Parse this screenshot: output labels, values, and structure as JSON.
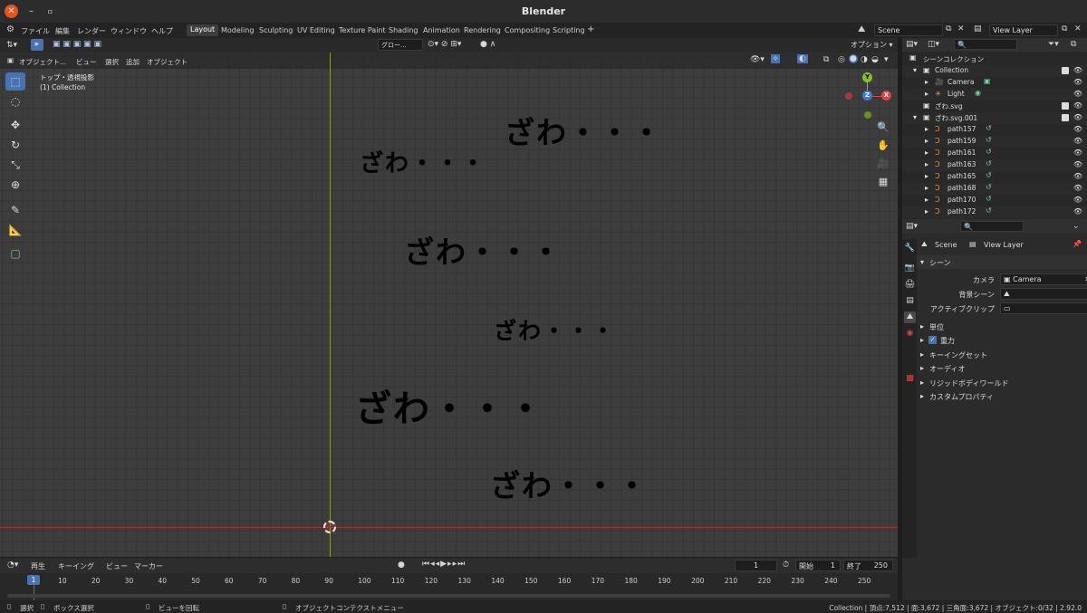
{
  "window": {
    "title": "Blender"
  },
  "menus": [
    "ファイル",
    "編集",
    "レンダー",
    "ウィンドウ",
    "ヘルプ"
  ],
  "workspaces": [
    "Layout",
    "Modeling",
    "Sculpting",
    "UV Editing",
    "Texture Paint",
    "Shading",
    "Animation",
    "Rendering",
    "Compositing",
    "Scripting"
  ],
  "active_workspace": "Layout",
  "scene_field": "Scene",
  "viewlayer_field": "View Layer",
  "viewport": {
    "mode": "オブジェクト...",
    "menu": [
      "ビュー",
      "選択",
      "追加",
      "オブジェクト"
    ],
    "transform": "グロー...",
    "options": "オプション",
    "overlay_title": "トップ・透視投影",
    "overlay_collection": "(1) Collection",
    "texts": [
      "ざわ・・・",
      "ざわ・・・",
      "ざわ・・・",
      "ざわ・・・",
      "ざわ・・・",
      "ざわ・・・"
    ],
    "gizmo": {
      "y": "Y",
      "z": "Z",
      "x": "X"
    }
  },
  "outliner": {
    "root": "シーンコレクション",
    "rows": [
      {
        "label": "Collection"
      },
      {
        "label": "Camera"
      },
      {
        "label": "Light"
      },
      {
        "label": "ざわ.svg"
      },
      {
        "label": "ざわ.svg.001"
      },
      {
        "label": "path157"
      },
      {
        "label": "path159"
      },
      {
        "label": "path161"
      },
      {
        "label": "path163"
      },
      {
        "label": "path165"
      },
      {
        "label": "path168"
      },
      {
        "label": "path170"
      },
      {
        "label": "path172"
      }
    ]
  },
  "properties": {
    "breadcrumb_scene": "Scene",
    "breadcrumb_layer": "View Layer",
    "section_scene": "シーン",
    "camera_label": "カメラ",
    "camera_value": "Camera",
    "bg_scene_label": "背景シーン",
    "active_clip_label": "アクティブクリップ",
    "panels": [
      "単位",
      "重力",
      "キーイングセット",
      "オーディオ",
      "リジッドボディワールド",
      "カスタムプロパティ"
    ]
  },
  "timeline": {
    "menu": [
      "再生",
      "キーイング",
      "ビュー",
      "マーカー"
    ],
    "current_frame": "1",
    "start_label": "開始",
    "start_value": "1",
    "end_label": "終了",
    "end_value": "250",
    "ticks": [
      "1",
      "10",
      "20",
      "30",
      "40",
      "50",
      "60",
      "70",
      "80",
      "90",
      "100",
      "110",
      "120",
      "130",
      "140",
      "150",
      "160",
      "170",
      "180",
      "190",
      "200",
      "210",
      "220",
      "230",
      "240",
      "250"
    ]
  },
  "status": {
    "select": "選択",
    "box_select": "ボックス選択",
    "rotate_view": "ビューを回転",
    "context_menu": "オブジェクトコンテクストメニュー",
    "stats": "Collection | 頂点:7,512 | 面:3,672 | 三角面:3,672 | オブジェクト:0/32 | 2.92.0"
  }
}
